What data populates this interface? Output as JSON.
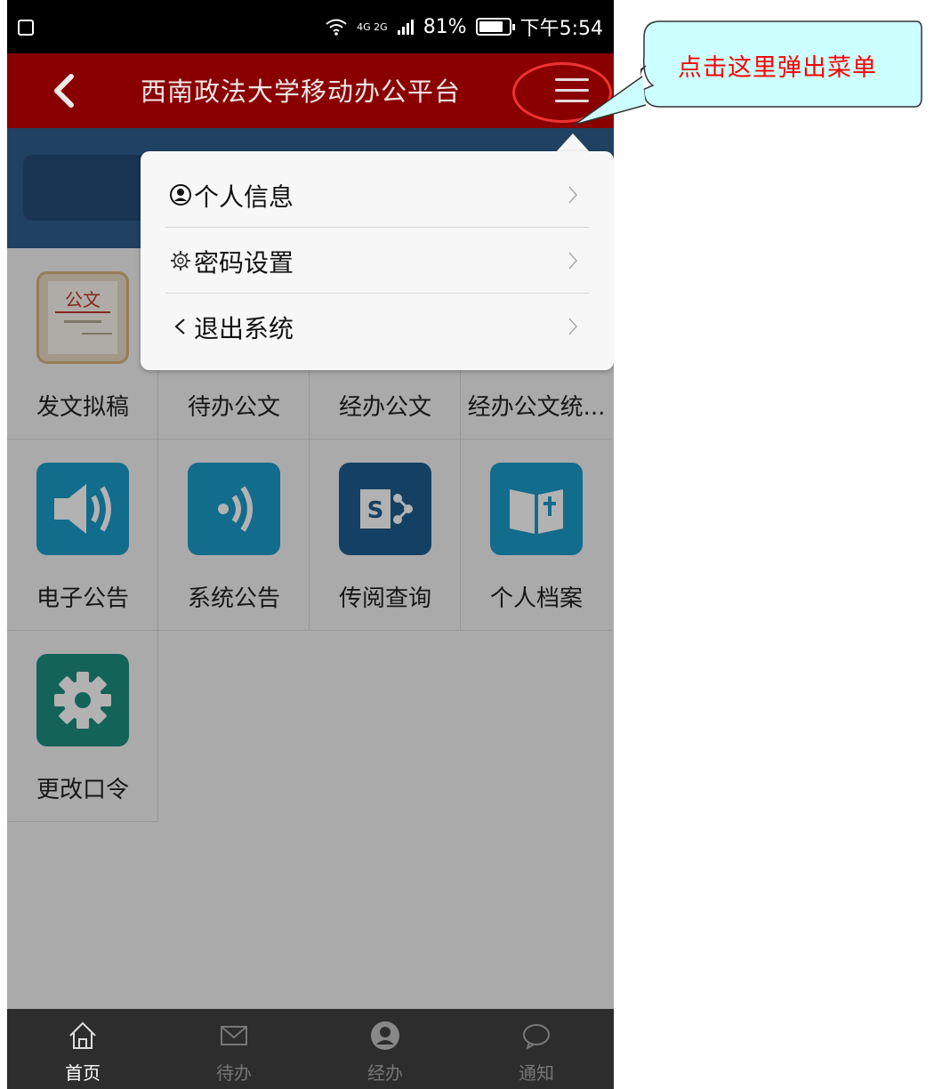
{
  "status_bar": {
    "network": "4G 2G",
    "battery": "81%",
    "battery_level": 0.81,
    "time": "下午5:54"
  },
  "title_bar": {
    "title": "西南政法大学移动办公平台",
    "back_icon": "chevron-left-icon",
    "menu_icon": "hamburger-icon"
  },
  "callout": {
    "text": "点击这里弹出菜单"
  },
  "dropdown": {
    "items": [
      {
        "icon": "user-circle-icon",
        "label": "个人信息"
      },
      {
        "icon": "gear-icon",
        "label": "密码设置"
      },
      {
        "icon": "chevron-left-icon",
        "label": "退出系统"
      }
    ]
  },
  "apps": [
    {
      "label": "发文拟稿",
      "icon": "document-icon"
    },
    {
      "label": "待办公文",
      "icon": "document-icon"
    },
    {
      "label": "经办公文",
      "icon": "document-icon"
    },
    {
      "label": "经办公文统...",
      "icon": "document-icon"
    },
    {
      "label": "电子公告",
      "icon": "speaker-icon",
      "color": "#1a9bc8"
    },
    {
      "label": "系统公告",
      "icon": "broadcast-icon",
      "color": "#1a9bc8"
    },
    {
      "label": "传阅查询",
      "icon": "sharepoint-icon",
      "color": "#1d5d8e"
    },
    {
      "label": "个人档案",
      "icon": "book-icon",
      "color": "#1a9bc8"
    },
    {
      "label": "更改口令",
      "icon": "gear-icon",
      "color": "#1e8f80"
    }
  ],
  "bottom_nav": [
    {
      "label": "首页",
      "icon": "home-icon",
      "active": true
    },
    {
      "label": "待办",
      "icon": "mail-icon",
      "active": false
    },
    {
      "label": "经办",
      "icon": "user-circle-icon",
      "active": false
    },
    {
      "label": "通知",
      "icon": "chat-bubble-icon",
      "active": false
    }
  ],
  "colors": {
    "title_bar": "#8a0000",
    "callout_fill": "#ccffff",
    "callout_text": "#ff0000",
    "annotation_ellipse": "#ee3333"
  }
}
